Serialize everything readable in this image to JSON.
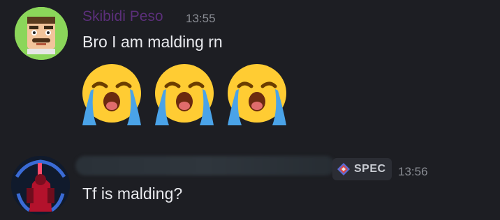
{
  "messages": [
    {
      "username": "Skibidi Peso",
      "timestamp": "13:55",
      "text": "Bro I am malding rn",
      "avatar_icon": "cartoon-face-avatar",
      "emojis": [
        "loudly-crying-face",
        "loudly-crying-face",
        "loudly-crying-face"
      ],
      "username_color": "#5b2f7a"
    },
    {
      "username_redacted": true,
      "tag": "SPEC",
      "tag_icon": "diamond-emblem-icon",
      "timestamp": "13:56",
      "text": "Tf is malding?",
      "avatar_icon": "red-figure-avatar"
    }
  ],
  "colors": {
    "background": "#1d1e23",
    "message_text": "#e9eaee",
    "timestamp": "#8a8d94",
    "tag_background": "#2b2d34"
  }
}
